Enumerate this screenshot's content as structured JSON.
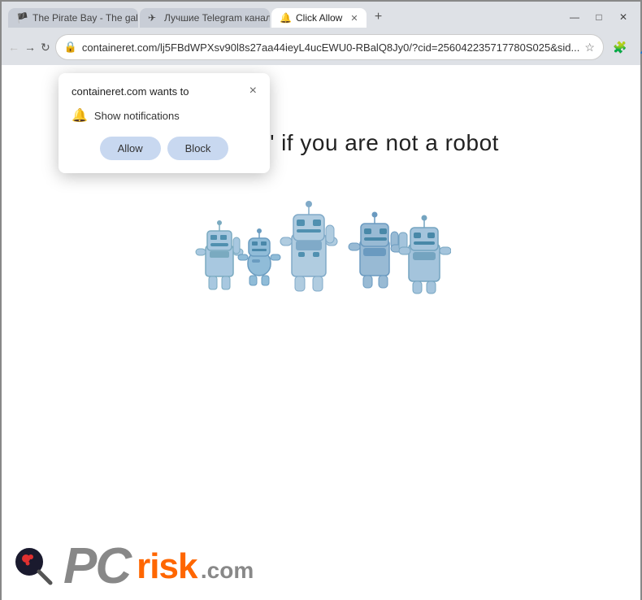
{
  "browser": {
    "title": "Click Allow",
    "tabs": [
      {
        "id": "tab1",
        "label": "The Pirate Bay - The galaxy's m...",
        "favicon": "🏴",
        "active": false
      },
      {
        "id": "tab2",
        "label": "Лучшие Telegram каналы | ТО...",
        "favicon": "✈",
        "active": false
      },
      {
        "id": "tab3",
        "label": "Click Allow",
        "favicon": "🔔",
        "active": true
      }
    ],
    "new_tab_label": "+",
    "address": "containeret.com/lj5FBdWPXsv90l8s27aa44ieyL4ucEWU0-RBalQ8Jy0/?cid=256042235717780S025&sid...",
    "window_controls": {
      "minimize": "—",
      "maximize": "□",
      "close": "✕"
    }
  },
  "popup": {
    "title": "containeret.com wants to",
    "close_label": "×",
    "permission": "Show notifications",
    "allow_label": "Allow",
    "block_label": "Block"
  },
  "page": {
    "main_text": "Click \"Allow\"   if you are not   a robot"
  },
  "footer": {
    "pc_text": "PC",
    "risk_text": "risk",
    "dot_com": ".com"
  },
  "icons": {
    "back": "←",
    "forward": "→",
    "refresh": "↻",
    "lock": "🔒",
    "star": "☆",
    "extensions": "🧩",
    "profile": "👤",
    "menu": "⋮",
    "bell": "🔔"
  }
}
